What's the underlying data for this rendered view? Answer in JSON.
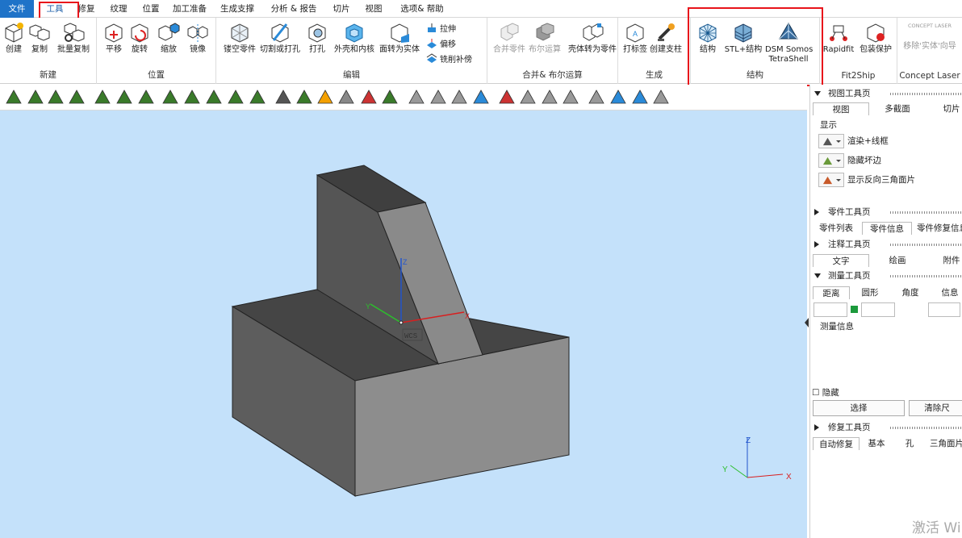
{
  "menu": {
    "items": [
      "文件",
      "工具",
      "修复",
      "纹理",
      "位置",
      "加工准备",
      "生成支撑",
      "分析 & 报告",
      "切片",
      "视图",
      "选项& 帮助"
    ]
  },
  "ribbon": {
    "groups": {
      "new": "新建",
      "position": "位置",
      "edit": "编辑",
      "merge": "合并& 布尔运算",
      "generate": "生成",
      "structure": "结构",
      "fit2ship": "Fit2Ship",
      "concept": "Concept Laser"
    },
    "buttons": {
      "create": "创建",
      "copy": "复制",
      "batch_copy": "批量复制",
      "translate": "平移",
      "rotate": "旋转",
      "scale": "缩放",
      "mirror": "镜像",
      "hollow": "镂空零件",
      "cut_punch": "切割或打孔",
      "punch": "打孔",
      "shell_core": "外壳和内核",
      "face_to_solid": "面转为实体",
      "extrude": "拉伸",
      "offset": "偏移",
      "mill_patch": "铣削补傍",
      "merge_parts": "合并零件",
      "boolean": "布尔运算",
      "shell_to_part": "壳体转为零件",
      "label": "打标签",
      "create_support": "创建支柱",
      "structure": "结构",
      "stl_structure": "STL+结构",
      "dsm": "DSM Somos",
      "tetrashell": "TetraShell",
      "rapidfit": "Rapidfit",
      "pack_protect": "包装保护",
      "remove_solid": "移除'实体'向导",
      "concept_logo": "CONCEPT LASER"
    }
  },
  "viewport": {
    "axis_z": "Z",
    "axis_y": "Y",
    "axis_x": "X",
    "wcs": "WCS",
    "tri_z": "Z",
    "tri_y": "Y",
    "tri_x": "X"
  },
  "panel": {
    "view_toolbar": "视图工具页",
    "view_tabs": [
      "视图",
      "多截面",
      "切片"
    ],
    "display": "显示",
    "render_wire": "渲染+线框",
    "hide_bad_edges": "隐藏坏边",
    "show_reversed": "显示反向三角面片",
    "part_toolbar": "零件工具页",
    "part_tabs": [
      "零件列表",
      "零件信息",
      "零件修复信息"
    ],
    "annot_toolbar": "注释工具页",
    "annot_tabs": [
      "文字",
      "绘画",
      "附件"
    ],
    "measure_toolbar": "测量工具页",
    "measure_tabs": [
      "距离",
      "圆形",
      "角度",
      "信息"
    ],
    "measure_info": "测量信息",
    "hide": "隐藏",
    "select": "选择",
    "clear": "清除尺",
    "repair_toolbar": "修复工具页",
    "repair_tabs": [
      "自动修复",
      "基本",
      "孔",
      "三角面片"
    ]
  },
  "watermark": "激活 Wi",
  "colors": {
    "accent": "#1f73c8",
    "highlight": "#e8141b",
    "viewport": "#c4e1fa",
    "face_light": "#8a8a8a",
    "face_dark": "#454545",
    "face_mid": "#5d5d5d"
  }
}
